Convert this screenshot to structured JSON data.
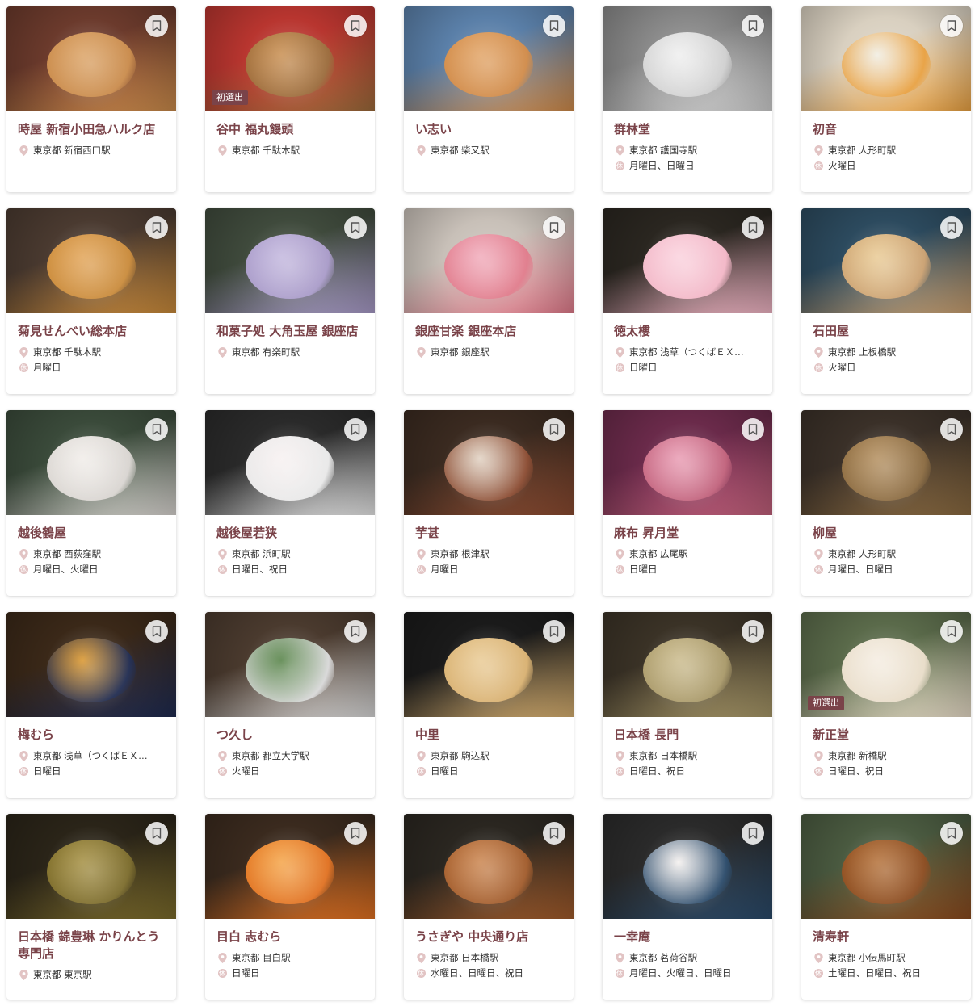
{
  "labels": {
    "first_time": "初選出"
  },
  "colors": {
    "accent": "#7a4349",
    "pin": "#e2c4c4"
  },
  "shops": [
    {
      "name": "時屋 新宿小田急ハルク店",
      "pref": "東京都",
      "station": "新宿西口駅",
      "closed": "",
      "badge": false,
      "photo": [
        "#6b3a2c",
        "#c98a4a",
        "#d99e5e"
      ]
    },
    {
      "name": "谷中 福丸饅頭",
      "pref": "東京都",
      "station": "千駄木駅",
      "closed": "",
      "badge": true,
      "photo": [
        "#b8352f",
        "#9a6a3a",
        "#c68a4a"
      ]
    },
    {
      "name": "い志い",
      "pref": "東京都",
      "station": "柴又駅",
      "closed": "",
      "badge": false,
      "photo": [
        "#5a7fa8",
        "#d08a48",
        "#e0a060"
      ]
    },
    {
      "name": "群林堂",
      "pref": "東京都",
      "station": "護国寺駅",
      "closed": "月曜日、日曜日",
      "badge": false,
      "photo": [
        "#888888",
        "#cfcfcf",
        "#eeeeee"
      ]
    },
    {
      "name": "初音",
      "pref": "東京都",
      "station": "人形町駅",
      "closed": "火曜日",
      "badge": false,
      "photo": [
        "#d9d0c0",
        "#e8a040",
        "#f0ece0"
      ]
    },
    {
      "name": "菊見せんべい総本店",
      "pref": "東京都",
      "station": "千駄木駅",
      "closed": "月曜日",
      "badge": false,
      "photo": [
        "#4a3a30",
        "#c98a3a",
        "#e0a050"
      ]
    },
    {
      "name": "和菓子処 大角玉屋 銀座店",
      "pref": "東京都",
      "station": "有楽町駅",
      "closed": "",
      "badge": false,
      "photo": [
        "#3f4a3c",
        "#a89ac8",
        "#c0b4dc"
      ]
    },
    {
      "name": "銀座甘楽 銀座本店",
      "pref": "東京都",
      "station": "銀座駅",
      "closed": "",
      "badge": false,
      "photo": [
        "#c8c0b8",
        "#e07a8a",
        "#f0a8b8"
      ]
    },
    {
      "name": "徳太樓",
      "pref": "東京都",
      "station": "浅草（つくばＥＸ…",
      "closed": "日曜日",
      "badge": false,
      "photo": [
        "#2a2620",
        "#f2b6c6",
        "#fad0dc"
      ]
    },
    {
      "name": "石田屋",
      "pref": "東京都",
      "station": "上板橋駅",
      "closed": "火曜日",
      "badge": false,
      "photo": [
        "#2c4a5e",
        "#caa070",
        "#e8c890"
      ]
    },
    {
      "name": "越後鶴屋",
      "pref": "東京都",
      "station": "西荻窪駅",
      "closed": "月曜日、火曜日",
      "badge": false,
      "photo": [
        "#3a4a3a",
        "#d8d4d0",
        "#f0ece8"
      ]
    },
    {
      "name": "越後屋若狭",
      "pref": "東京都",
      "station": "浜町駅",
      "closed": "日曜日、祝日",
      "badge": false,
      "photo": [
        "#2a2a2a",
        "#e8e8e8",
        "#f6f0f0"
      ]
    },
    {
      "name": "芋甚",
      "pref": "東京都",
      "station": "根津駅",
      "closed": "月曜日",
      "badge": false,
      "photo": [
        "#3a2a20",
        "#8a4a30",
        "#e0d0c0"
      ]
    },
    {
      "name": "麻布 昇月堂",
      "pref": "東京都",
      "station": "広尾駅",
      "closed": "日曜日",
      "badge": false,
      "photo": [
        "#6a2a4a",
        "#c0607a",
        "#e898b0"
      ]
    },
    {
      "name": "柳屋",
      "pref": "東京都",
      "station": "人形町駅",
      "closed": "月曜日、日曜日",
      "badge": false,
      "photo": [
        "#3a3028",
        "#8a6a40",
        "#b08a58"
      ]
    },
    {
      "name": "梅むら",
      "pref": "東京都",
      "station": "浅草（つくばＥＸ…",
      "closed": "日曜日",
      "badge": false,
      "photo": [
        "#3a2818",
        "#1e2a50",
        "#d89020"
      ]
    },
    {
      "name": "つ久し",
      "pref": "東京都",
      "station": "都立大学駅",
      "closed": "火曜日",
      "badge": false,
      "photo": [
        "#4a3a2e",
        "#d8d8d8",
        "#4a7a3a"
      ]
    },
    {
      "name": "中里",
      "pref": "東京都",
      "station": "駒込駅",
      "closed": "日曜日",
      "badge": false,
      "photo": [
        "#1a1a1a",
        "#d8b070",
        "#e8c890"
      ]
    },
    {
      "name": "日本橋 長門",
      "pref": "東京都",
      "station": "日本橋駅",
      "closed": "日曜日、祝日",
      "badge": false,
      "photo": [
        "#3a3226",
        "#a89868",
        "#c8b888"
      ]
    },
    {
      "name": "新正堂",
      "pref": "東京都",
      "station": "新橋駅",
      "closed": "日曜日、祝日",
      "badge": true,
      "photo": [
        "#5a6a4a",
        "#e8dcc8",
        "#f4ece0"
      ]
    },
    {
      "name": "日本橋 錦豊琳 かりんとう専門店",
      "pref": "東京都",
      "station": "東京駅",
      "closed": "",
      "badge": false,
      "photo": [
        "#2a2418",
        "#7a6a2a",
        "#a08a3a"
      ]
    },
    {
      "name": "目白 志むら",
      "pref": "東京都",
      "station": "目白駅",
      "closed": "日曜日",
      "badge": false,
      "photo": [
        "#3a2a1e",
        "#e07020",
        "#f4a040"
      ]
    },
    {
      "name": "うさぎや 中央通り店",
      "pref": "東京都",
      "station": "日本橋駅",
      "closed": "水曜日、日曜日、祝日",
      "badge": false,
      "photo": [
        "#2a2620",
        "#a05a2a",
        "#c88048"
      ]
    },
    {
      "name": "一幸庵",
      "pref": "東京都",
      "station": "茗荷谷駅",
      "closed": "月曜日、火曜日、日曜日",
      "badge": false,
      "photo": [
        "#2a2a2a",
        "#2a4a6a",
        "#f4f0ee"
      ]
    },
    {
      "name": "清寿軒",
      "pref": "東京都",
      "station": "小伝馬町駅",
      "closed": "土曜日、日曜日、祝日",
      "badge": false,
      "photo": [
        "#4a5a40",
        "#8a4a1e",
        "#b06a30"
      ]
    }
  ]
}
